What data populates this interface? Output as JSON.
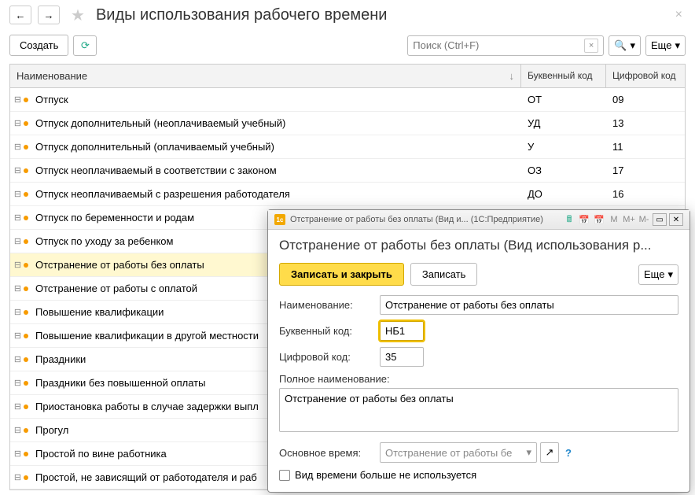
{
  "header": {
    "title": "Виды использования рабочего времени"
  },
  "toolbar": {
    "create": "Создать",
    "search_placeholder": "Поиск (Ctrl+F)",
    "more": "Еще"
  },
  "columns": {
    "name": "Наименование",
    "letter": "Буквенный код",
    "digit": "Цифровой код"
  },
  "rows": [
    {
      "name": "Отпуск",
      "letter": "ОТ",
      "digit": "09"
    },
    {
      "name": "Отпуск дополнительный (неоплачиваемый учебный)",
      "letter": "УД",
      "digit": "13"
    },
    {
      "name": "Отпуск дополнительный (оплачиваемый учебный)",
      "letter": "У",
      "digit": "11"
    },
    {
      "name": "Отпуск неоплачиваемый в соответствии с законом",
      "letter": "ОЗ",
      "digit": "17"
    },
    {
      "name": "Отпуск неоплачиваемый с разрешения работодателя",
      "letter": "ДО",
      "digit": "16"
    },
    {
      "name": "Отпуск по беременности и родам",
      "letter": "",
      "digit": ""
    },
    {
      "name": "Отпуск по уходу за ребенком",
      "letter": "",
      "digit": ""
    },
    {
      "name": "Отстранение от работы без оплаты",
      "letter": "",
      "digit": "",
      "selected": true
    },
    {
      "name": "Отстранение от работы с оплатой",
      "letter": "",
      "digit": ""
    },
    {
      "name": "Повышение квалификации",
      "letter": "",
      "digit": ""
    },
    {
      "name": "Повышение квалификации в другой местности",
      "letter": "",
      "digit": ""
    },
    {
      "name": "Праздники",
      "letter": "",
      "digit": ""
    },
    {
      "name": "Праздники без повышенной оплаты",
      "letter": "",
      "digit": ""
    },
    {
      "name": "Приостановка работы в случае задержки выпл",
      "letter": "",
      "digit": ""
    },
    {
      "name": "Прогул",
      "letter": "",
      "digit": ""
    },
    {
      "name": "Простой по вине работника",
      "letter": "",
      "digit": ""
    },
    {
      "name": "Простой, не зависящий от работодателя и раб",
      "letter": "",
      "digit": ""
    }
  ],
  "modal": {
    "titlebar": "Отстранение от работы без оплаты (Вид и... (1С:Предприятие)",
    "heading": "Отстранение от работы без оплаты (Вид использования р...",
    "save_close": "Записать и закрыть",
    "save": "Записать",
    "more": "Еще",
    "label_name": "Наименование:",
    "field_name": "Отстранение от работы без оплаты",
    "label_letter": "Буквенный код:",
    "field_letter": "НБ1",
    "label_digit": "Цифровой код:",
    "field_digit": "35",
    "label_full": "Полное наименование:",
    "field_full": "Отстранение от работы без оплаты",
    "label_base": "Основное время:",
    "field_base": "Отстранение от работы бе",
    "checkbox_label": "Вид времени больше не используется",
    "m_labels": {
      "m": "M",
      "mplus": "M+",
      "mminus": "M-"
    }
  }
}
